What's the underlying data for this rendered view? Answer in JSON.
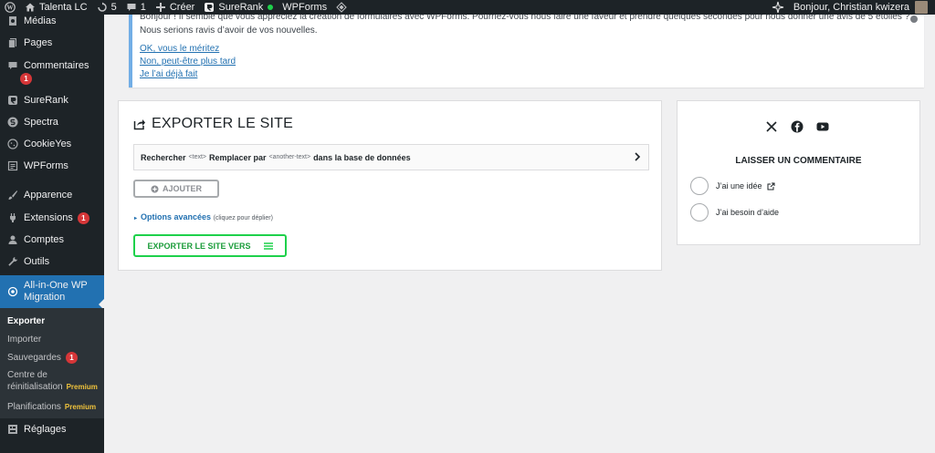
{
  "admin_bar": {
    "site_name": "Talenta LC",
    "updates_count": "5",
    "comments_count": "1",
    "create_label": "Créer",
    "surerank_label": "SureRank",
    "wpforms_label": "WPForms",
    "greeting": "Bonjour, Christian kwizera"
  },
  "sidebar": {
    "items": [
      {
        "label": "Médias",
        "icon": "media-icon"
      },
      {
        "label": "Pages",
        "icon": "pages-icon"
      },
      {
        "label": "Commentaires",
        "icon": "comments-icon",
        "badge": "1"
      },
      {
        "label": "SureRank",
        "icon": "surerank-icon"
      },
      {
        "label": "Spectra",
        "icon": "spectra-icon"
      },
      {
        "label": "CookieYes",
        "icon": "cookie-icon"
      },
      {
        "label": "WPForms",
        "icon": "wpforms-icon"
      },
      {
        "label": "Apparence",
        "icon": "brush-icon"
      },
      {
        "label": "Extensions",
        "icon": "plugin-icon",
        "badge": "1"
      },
      {
        "label": "Comptes",
        "icon": "user-icon"
      },
      {
        "label": "Outils",
        "icon": "wrench-icon"
      },
      {
        "label_line1": "All-in-One WP",
        "label_line2": "Migration",
        "icon": "migration-icon"
      },
      {
        "label": "Réglages",
        "icon": "settings-icon"
      }
    ],
    "submenu": {
      "export": "Exporter",
      "import": "Importer",
      "backups": "Sauvegardes",
      "backups_badge": "1",
      "reset_line1": "Centre de",
      "reset_line2": "réinitialisation",
      "schedules": "Planifications",
      "premium": "Premium"
    }
  },
  "notice": {
    "line1": "Bonjour ! Il semble que vous appréciez la création de formulaires avec WPForms. Pourriez-vous nous faire une faveur et prendre quelques secondes pour nous donner une avis de 5 étoiles ?",
    "line2": "Nous serions ravis d’avoir de vos nouvelles.",
    "link1": "OK, vous le méritez",
    "link2": "Non, peut-être plus tard",
    "link3": "Je l’ai déjà fait"
  },
  "export": {
    "title": "EXPORTER LE SITE",
    "search_label": "Rechercher",
    "text_placeholder": "<text>",
    "replace_label": "Remplacer par",
    "another_text_placeholder": "<another-text>",
    "in_db_label": "dans la base de données",
    "add_button": "AJOUTER",
    "advanced_label": "Options avancées",
    "advanced_hint": "(cliquez pour déplier)",
    "export_button": "EXPORTER LE SITE VERS"
  },
  "feedback": {
    "title": "LAISSER UN COMMENTAIRE",
    "idea_label": "J’ai une idée",
    "help_label": "J’ai besoin d’aide"
  },
  "colors": {
    "admin_dark": "#1d2327",
    "link_blue": "#2271b1",
    "export_green": "#1ed14b",
    "badge_red": "#d63638"
  }
}
